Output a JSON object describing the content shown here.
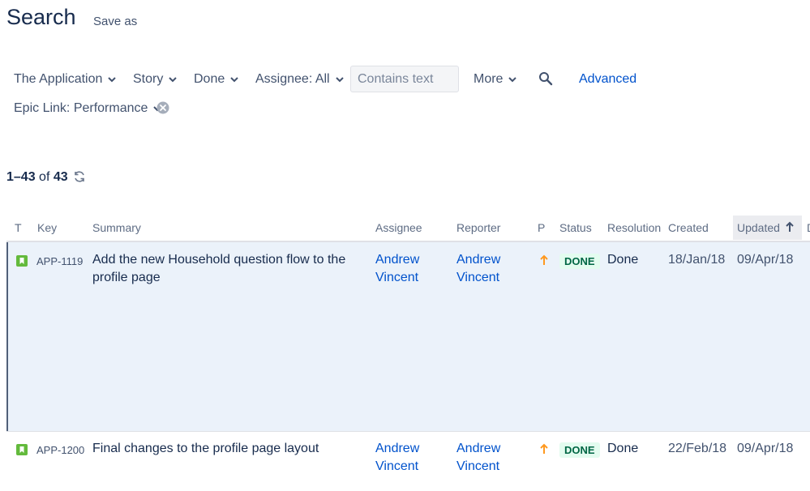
{
  "header": {
    "title": "Search",
    "save_as": "Save as"
  },
  "filters": {
    "project": "The Application",
    "type": "Story",
    "status": "Done",
    "assignee": "Assignee: All",
    "text_placeholder": "Contains text",
    "more": "More",
    "advanced": "Advanced",
    "epic_link": "Epic Link: Performance"
  },
  "results": {
    "range": "1–43",
    "of": "of",
    "total": "43"
  },
  "columns": {
    "t": "T",
    "key": "Key",
    "summary": "Summary",
    "assignee": "Assignee",
    "reporter": "Reporter",
    "p": "P",
    "status": "Status",
    "resolution": "Resolution",
    "created": "Created",
    "updated": "Updated",
    "next": "D"
  },
  "rows": [
    {
      "key": "APP-1119",
      "summary_line1": "Add the new Household question flow to the",
      "summary_line2": "profile page",
      "assignee_first": "Andrew",
      "assignee_last": "Vincent",
      "reporter_first": "Andrew",
      "reporter_last": "Vincent",
      "status": "DONE",
      "resolution": "Done",
      "created": "18/Jan/18",
      "updated": "09/Apr/18"
    },
    {
      "key": "APP-1200",
      "summary_line1": "Final changes to the profile page layout",
      "assignee_first": "Andrew",
      "assignee_last": "Vincent",
      "reporter_first": "Andrew",
      "reporter_last": "Vincent",
      "status": "DONE",
      "resolution": "Done",
      "created": "22/Feb/18",
      "updated": "09/Apr/18"
    }
  ],
  "colors": {
    "accent": "#0052cc",
    "story": "#63ba3c",
    "priority": "#ff991f",
    "done_bg": "#e3fcef",
    "done_text": "#006644",
    "selected_row": "#ebf2fa"
  }
}
